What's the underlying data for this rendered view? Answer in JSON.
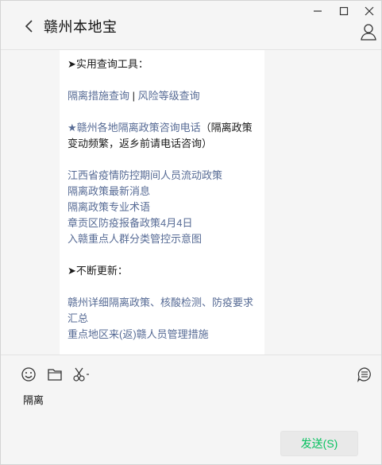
{
  "window": {
    "title": "赣州本地宝"
  },
  "message": {
    "tools_heading": "➤实用查询工具：",
    "link_isolation_query": "隔离措施查询",
    "separator": "|",
    "link_risk_query": "风险等级查询",
    "hotline": "★赣州各地隔离政策咨询电话",
    "hotline_note": "（隔离政策变动频繁，返乡前请电话咨询）",
    "links": [
      "江西省疫情防控期间人员流动政策",
      "隔离政策最新消息",
      "隔离政策专业术语",
      "章贡区防疫报备政策4月4日",
      "入赣重点人群分类管控示意图"
    ],
    "updates_heading": "➤不断更新：",
    "update_links": [
      "赣州详细隔离政策、核酸检测、防疫要求汇总",
      "重点地区来(返)赣人员管理措施"
    ]
  },
  "input": {
    "draft": "隔离",
    "send_label": "发送(S)"
  },
  "icons": {
    "back": "chevron-left-icon",
    "minimize": "minimize-icon",
    "maximize": "maximize-icon",
    "close": "close-icon",
    "user": "user-icon",
    "emoji": "emoji-icon",
    "folder": "folder-icon",
    "scissors": "scissors-icon",
    "chat_history": "chat-history-icon"
  },
  "colors": {
    "link": "#576b95",
    "send_text": "#07c160",
    "background": "#f5f5f5"
  }
}
